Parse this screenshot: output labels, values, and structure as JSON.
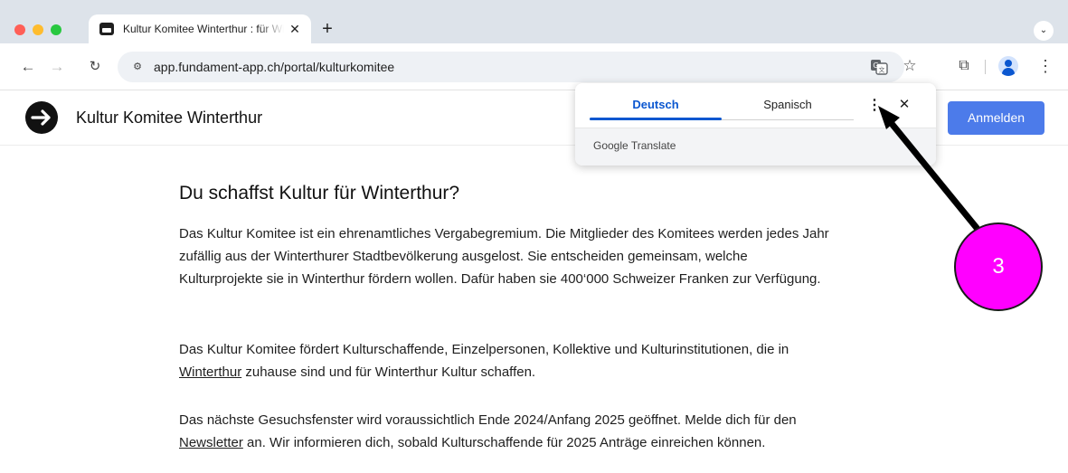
{
  "browser": {
    "tab_title": "Kultur Komitee Winterthur : für Winterthurer Kulturschaffende",
    "tab_close": "✕",
    "new_tab": "+",
    "tab_search": "⌄",
    "url": "app.fundament-app.ch/portal/kulturkomitee",
    "site_info_icon": "⚙",
    "back": "←",
    "forward": "→",
    "reload": "↻",
    "bookmark": "☆",
    "extensions": "⧉",
    "menu": "⋮"
  },
  "site": {
    "name": "Kultur Komitee Winterthur",
    "login_label": "Anmelden",
    "accent": "#4c7bea"
  },
  "content": {
    "heading": "Du schaffst Kultur für Winterthur?",
    "p1": "Das Kultur Komitee ist ein ehrenamtliches Vergabegremium. Die Mitglieder des Komitees werden jedes Jahr zufällig aus der Winterthurer Stadtbevölkerung ausgelost. Sie entscheiden gemeinsam, welche Kulturprojekte sie in Winterthur fördern wollen. Dafür haben sie 400‘000 Schweizer Franken zur Verfügung.",
    "p2_before": "Das Kultur Komitee fördert Kulturschaffende, Einzelpersonen, Kollektive und Kulturinstitutionen, die in ",
    "p2_link": "Winterthur",
    "p2_after": " zuhause sind und für Winterthur Kultur schaffen.",
    "p3_before": "Das nächste Gesuchsfenster wird voraussichtlich Ende 2024/Anfang 2025 geöffnet. Melde dich für den ",
    "p3_link": "Newsletter",
    "p3_after": " an. Wir informieren dich, sobald Kulturschaffende für 2025 Anträge einreichen können."
  },
  "translate_popup": {
    "source_language": "Deutsch",
    "target_language": "Spanisch",
    "more_options": "⋮",
    "close": "✕",
    "provider": "Google Translate"
  },
  "annotation": {
    "step_number": "3",
    "color": "#ff00ff"
  }
}
